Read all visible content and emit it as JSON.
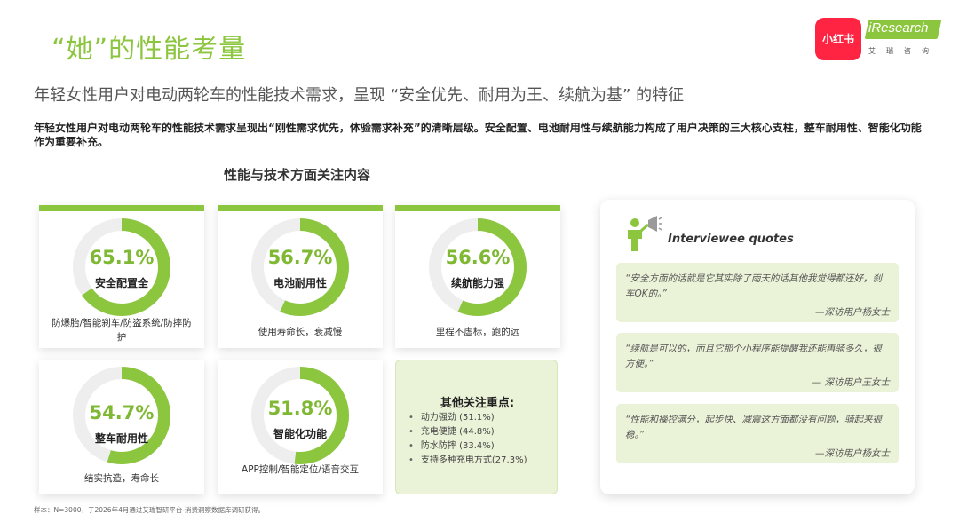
{
  "header": {
    "title": "“她”的性能考量",
    "subtitle": "年轻女性用户对电动两轮车的性能技术需求，呈现 “安全优先、耐用为王、续航为基” 的特征",
    "description": "年轻女性用户对电动两轮车的性能技术需求呈现出“刚性需求优先，体验需求补充”的清晰层级。安全配置、电池耐用性与续航能力构成了用户决策的三大核心支柱，整车耐用性、智能化功能作为重要补充。",
    "logo_xhs": "小红书",
    "logo_ir": "iResearch",
    "logo_ir_cn": "艾瑞咨询"
  },
  "chart_data": {
    "type": "donut",
    "title": "性能与技术方面关注内容",
    "accent_color": "#8cc63f",
    "track_color": "#eeeeee",
    "items": [
      {
        "label": "安全配置全",
        "value": 65.1,
        "display": "65.1%",
        "sub": "防爆胎/智能刹车/防盗系统/防摔防护"
      },
      {
        "label": "电池耐用性",
        "value": 56.7,
        "display": "56.7%",
        "sub": "使用寿命长，衰减慢"
      },
      {
        "label": "续航能力强",
        "value": 56.6,
        "display": "56.6%",
        "sub": "里程不虚标，跑的远"
      },
      {
        "label": "整车耐用性",
        "value": 54.7,
        "display": "54.7%",
        "sub": "结实抗造，寿命长"
      },
      {
        "label": "智能化功能",
        "value": 51.8,
        "display": "51.8%",
        "sub": "APP控制/智能定位/语音交互"
      }
    ],
    "other": {
      "title": "其他关注重点:",
      "items": [
        "动力强劲 (51.1%)",
        "充电便捷 (44.8%)",
        "防水防摔 (33.4%)",
        "支持多种充电方式(27.3%)"
      ]
    }
  },
  "quotes": {
    "heading": "Interviewee quotes",
    "icon": "speaker-megaphone-icon",
    "items": [
      {
        "text": "“安全方面的话就是它其实除了雨天的话其他我觉得都还好，刹车OK的。”",
        "source": "—深访用户杨女士"
      },
      {
        "text": "“续航是可以的，而且它那个小程序能提醒我还能再骑多久，很方便。”",
        "source": "— 深访用户王女士"
      },
      {
        "text": "“性能和操控满分，起步快、减震这方面都没有问题，骑起来很稳。”",
        "source": "—深访用户杨女士"
      }
    ]
  },
  "footnote": "样本：N=3000，于2026年4月通过艾瑞智研平台-消费洞察数据库调研获得。"
}
